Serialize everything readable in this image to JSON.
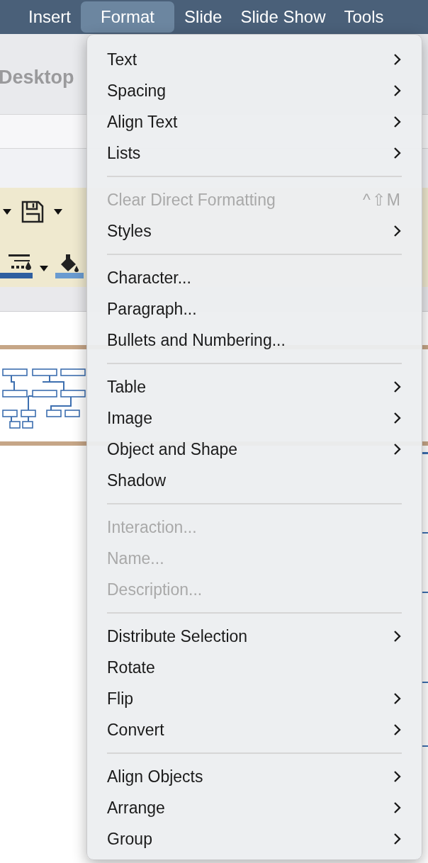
{
  "menubar": {
    "items": [
      {
        "label": "Insert",
        "selected": false
      },
      {
        "label": "Format",
        "selected": true
      },
      {
        "label": "Slide",
        "selected": false
      },
      {
        "label": "Slide Show",
        "selected": false
      },
      {
        "label": "Tools",
        "selected": false
      }
    ]
  },
  "window": {
    "title": "Desktop"
  },
  "menu": {
    "sections": [
      [
        {
          "label": "Text",
          "submenu": true,
          "disabled": false
        },
        {
          "label": "Spacing",
          "submenu": true,
          "disabled": false
        },
        {
          "label": "Align Text",
          "submenu": true,
          "disabled": false
        },
        {
          "label": "Lists",
          "submenu": true,
          "disabled": false
        }
      ],
      [
        {
          "label": "Clear Direct Formatting",
          "submenu": false,
          "disabled": true,
          "shortcut": "^⇧M"
        },
        {
          "label": "Styles",
          "submenu": true,
          "disabled": false
        }
      ],
      [
        {
          "label": "Character...",
          "submenu": false,
          "disabled": false
        },
        {
          "label": "Paragraph...",
          "submenu": false,
          "disabled": false
        },
        {
          "label": "Bullets and Numbering...",
          "submenu": false,
          "disabled": false
        }
      ],
      [
        {
          "label": "Table",
          "submenu": true,
          "disabled": false
        },
        {
          "label": "Image",
          "submenu": true,
          "disabled": false
        },
        {
          "label": "Object and Shape",
          "submenu": true,
          "disabled": false
        },
        {
          "label": "Shadow",
          "submenu": false,
          "disabled": false
        }
      ],
      [
        {
          "label": "Interaction...",
          "submenu": false,
          "disabled": true
        },
        {
          "label": "Name...",
          "submenu": false,
          "disabled": true
        },
        {
          "label": "Description...",
          "submenu": false,
          "disabled": true
        }
      ],
      [
        {
          "label": "Distribute Selection",
          "submenu": true,
          "disabled": false
        },
        {
          "label": "Rotate",
          "submenu": false,
          "disabled": false
        },
        {
          "label": "Flip",
          "submenu": true,
          "disabled": false
        },
        {
          "label": "Convert",
          "submenu": true,
          "disabled": false
        }
      ],
      [
        {
          "label": "Align Objects",
          "submenu": true,
          "disabled": false
        },
        {
          "label": "Arrange",
          "submenu": true,
          "disabled": false
        },
        {
          "label": "Group",
          "submenu": true,
          "disabled": false
        }
      ]
    ]
  }
}
